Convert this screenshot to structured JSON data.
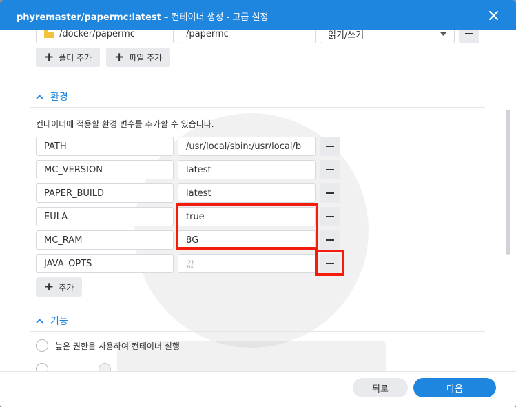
{
  "window": {
    "title_bold": "phyremaster/papermc:latest",
    "title_rest": " – 컨테이너 생성 - 고급 설정"
  },
  "volume": {
    "host_path": "/docker/papermc",
    "mount_path": "/papermc",
    "mode": "읽기/쓰기"
  },
  "volume_buttons": {
    "add_folder": "폴더 추가",
    "add_file": "파일 추가"
  },
  "env": {
    "heading": "환경",
    "description": "컨테이너에 적용할 환경 변수를 추가할 수 있습니다.",
    "rows": [
      {
        "name": "PATH",
        "value": "/usr/local/sbin:/usr/local/b"
      },
      {
        "name": "MC_VERSION",
        "value": "latest"
      },
      {
        "name": "PAPER_BUILD",
        "value": "latest"
      },
      {
        "name": "EULA",
        "value": "true"
      },
      {
        "name": "MC_RAM",
        "value": "8G"
      },
      {
        "name": "JAVA_OPTS",
        "value": ""
      }
    ],
    "value_placeholder": "값",
    "add_label": "추가"
  },
  "features": {
    "heading": "기능",
    "option_privileged": "높은 권한을 사용하여 컨테이너 실행"
  },
  "footer": {
    "back": "뒤로",
    "next": "다음"
  },
  "colors": {
    "accent": "#1f86e0",
    "highlight": "#f41c0c"
  }
}
